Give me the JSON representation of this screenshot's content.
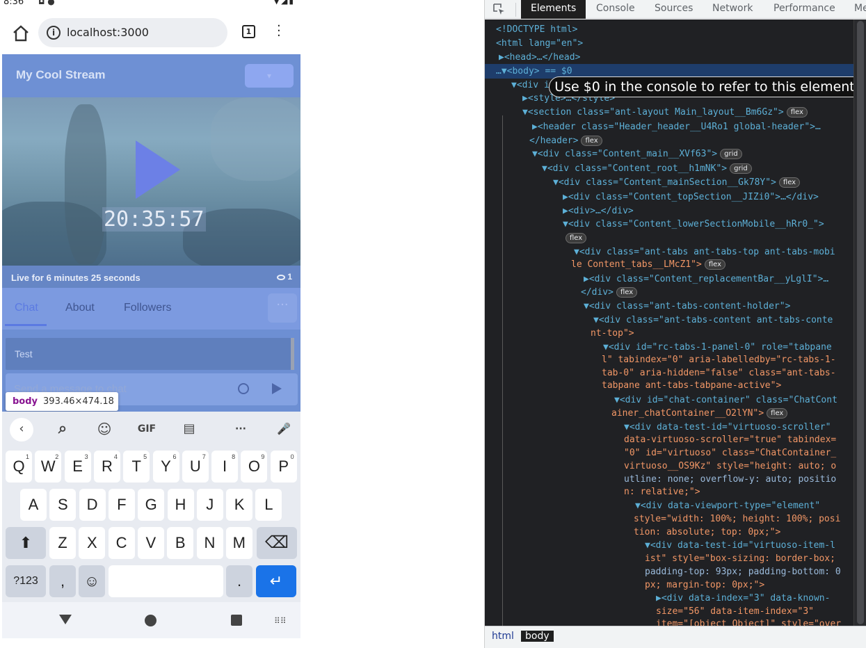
{
  "status_bar": {
    "time": "8:36",
    "left_icons": "◘ ●",
    "right_icons": "▼◢▮"
  },
  "browser": {
    "url": "localhost:3000",
    "tab_count": "1"
  },
  "stream": {
    "title": "My Cool Stream",
    "timer": "20:35:57",
    "live_text": "Live for 6 minutes 25 seconds",
    "viewer_count": "1",
    "tabs": [
      "Chat",
      "About",
      "Followers"
    ],
    "more_label": "···",
    "chat_message": "Test",
    "input_placeholder": "Send a message to chat"
  },
  "inspect_tooltip": {
    "tag": "body",
    "size": "393.46×474.18"
  },
  "keyboard": {
    "toolbar": {
      "back": "‹",
      "search": "⌕",
      "sticker": "☺",
      "gif": "GIF",
      "clipboard": "▤",
      "more": "···",
      "mic": "🎤"
    },
    "row1": [
      {
        "k": "Q",
        "n": "1"
      },
      {
        "k": "W",
        "n": "2"
      },
      {
        "k": "E",
        "n": "3"
      },
      {
        "k": "R",
        "n": "4"
      },
      {
        "k": "T",
        "n": "5"
      },
      {
        "k": "Y",
        "n": "6"
      },
      {
        "k": "U",
        "n": "7"
      },
      {
        "k": "I",
        "n": "8"
      },
      {
        "k": "O",
        "n": "9"
      },
      {
        "k": "P",
        "n": "0"
      }
    ],
    "row2": [
      "A",
      "S",
      "D",
      "F",
      "G",
      "H",
      "J",
      "K",
      "L"
    ],
    "row3": [
      "Z",
      "X",
      "C",
      "V",
      "B",
      "N",
      "M"
    ],
    "shift": "⬆",
    "backspace": "⌫",
    "symbols": "?123",
    "comma": ",",
    "emoji": "☺",
    "period": ".",
    "enter": "↵"
  },
  "devtools": {
    "tabs": [
      "Elements",
      "Console",
      "Sources",
      "Network",
      "Performance",
      "Me"
    ],
    "tooltip": "Use $0 in the console to refer to this element.",
    "crumbs": [
      "html",
      "body"
    ],
    "lines": [
      {
        "t": "<!DOCTYPE html>"
      },
      {
        "t": "<html lang=\"en\">"
      },
      {
        "t": "▶<head>…</head>"
      },
      {
        "t": "…▼<body> == $0"
      },
      {
        "t": "▼<div i"
      },
      {
        "t": "▶<style>…</style>"
      },
      {
        "t": "▼<section class=\"ant-layout Main_layout__Bm6Gz\">",
        "pill": "flex"
      },
      {
        "t": "▶<header class=\"Header_header__U4Ro1 global-header\">…"
      },
      {
        "t": "</header>",
        "pill": "flex"
      },
      {
        "t": "▼<div class=\"Content_main__XVf63\">",
        "pill": "grid"
      },
      {
        "t": "▼<div class=\"Content_root__h1mNK\">",
        "pill": "grid"
      },
      {
        "t": "▼<div class=\"Content_mainSection__Gk78Y\">",
        "pill": "flex"
      },
      {
        "t": "▶<div class=\"Content_topSection__JIZi0\">…</div>"
      },
      {
        "t": "▶<div>…</div>"
      },
      {
        "t": "▼<div class=\"Content_lowerSectionMobile__hRr0_\">"
      },
      {
        "t": "",
        "pill": "flex"
      },
      {
        "t": "▼<div class=\"ant-tabs ant-tabs-top ant-tabs-mobi"
      },
      {
        "t": "le Content_tabs__LMcZ1\">",
        "pill": "flex"
      },
      {
        "t": "▶<div class=\"Content_replacementBar__yLglI\">…"
      },
      {
        "t": "</div>",
        "pill": "flex"
      },
      {
        "t": "▼<div class=\"ant-tabs-content-holder\">"
      },
      {
        "t": "▼<div class=\"ant-tabs-content ant-tabs-conte"
      },
      {
        "t": "nt-top\">"
      },
      {
        "t": "▼<div id=\"rc-tabs-1-panel-0\" role=\"tabpane"
      },
      {
        "t": "l\" tabindex=\"0\" aria-labelledby=\"rc-tabs-1-"
      },
      {
        "t": "tab-0\" aria-hidden=\"false\" class=\"ant-tabs-"
      },
      {
        "t": "tabpane ant-tabs-tabpane-active\">"
      },
      {
        "t": "▼<div id=\"chat-container\" class=\"ChatCont"
      },
      {
        "t": "ainer_chatContainer__O2lYN\">",
        "pill": "flex"
      },
      {
        "t": "▼<div data-test-id=\"virtuoso-scroller\""
      },
      {
        "t": "data-virtuoso-scroller=\"true\" tabindex="
      },
      {
        "t": "\"0\" id=\"virtuoso\" class=\"ChatContainer_"
      },
      {
        "t": "virtuoso__OS9Kz\" style=\"height: auto; o"
      },
      {
        "t": "utline: none; overflow-y: auto; positio"
      },
      {
        "t": "n: relative;\">"
      },
      {
        "t": "▼<div data-viewport-type=\"element\""
      },
      {
        "t": "style=\"width: 100%; height: 100%; posi"
      },
      {
        "t": "tion: absolute; top: 0px;\">"
      },
      {
        "t": "▼<div data-test-id=\"virtuoso-item-l"
      },
      {
        "t": "ist\" style=\"box-sizing: border-box;"
      },
      {
        "t": "padding-top: 93px; padding-bottom: 0"
      },
      {
        "t": "px; margin-top: 0px;\">"
      },
      {
        "t": "▶<div data-index=\"3\" data-known-"
      },
      {
        "t": "size=\"56\" data-item-index=\"3\""
      },
      {
        "t": "item=\"[object Object]\" style=\"over"
      }
    ]
  }
}
